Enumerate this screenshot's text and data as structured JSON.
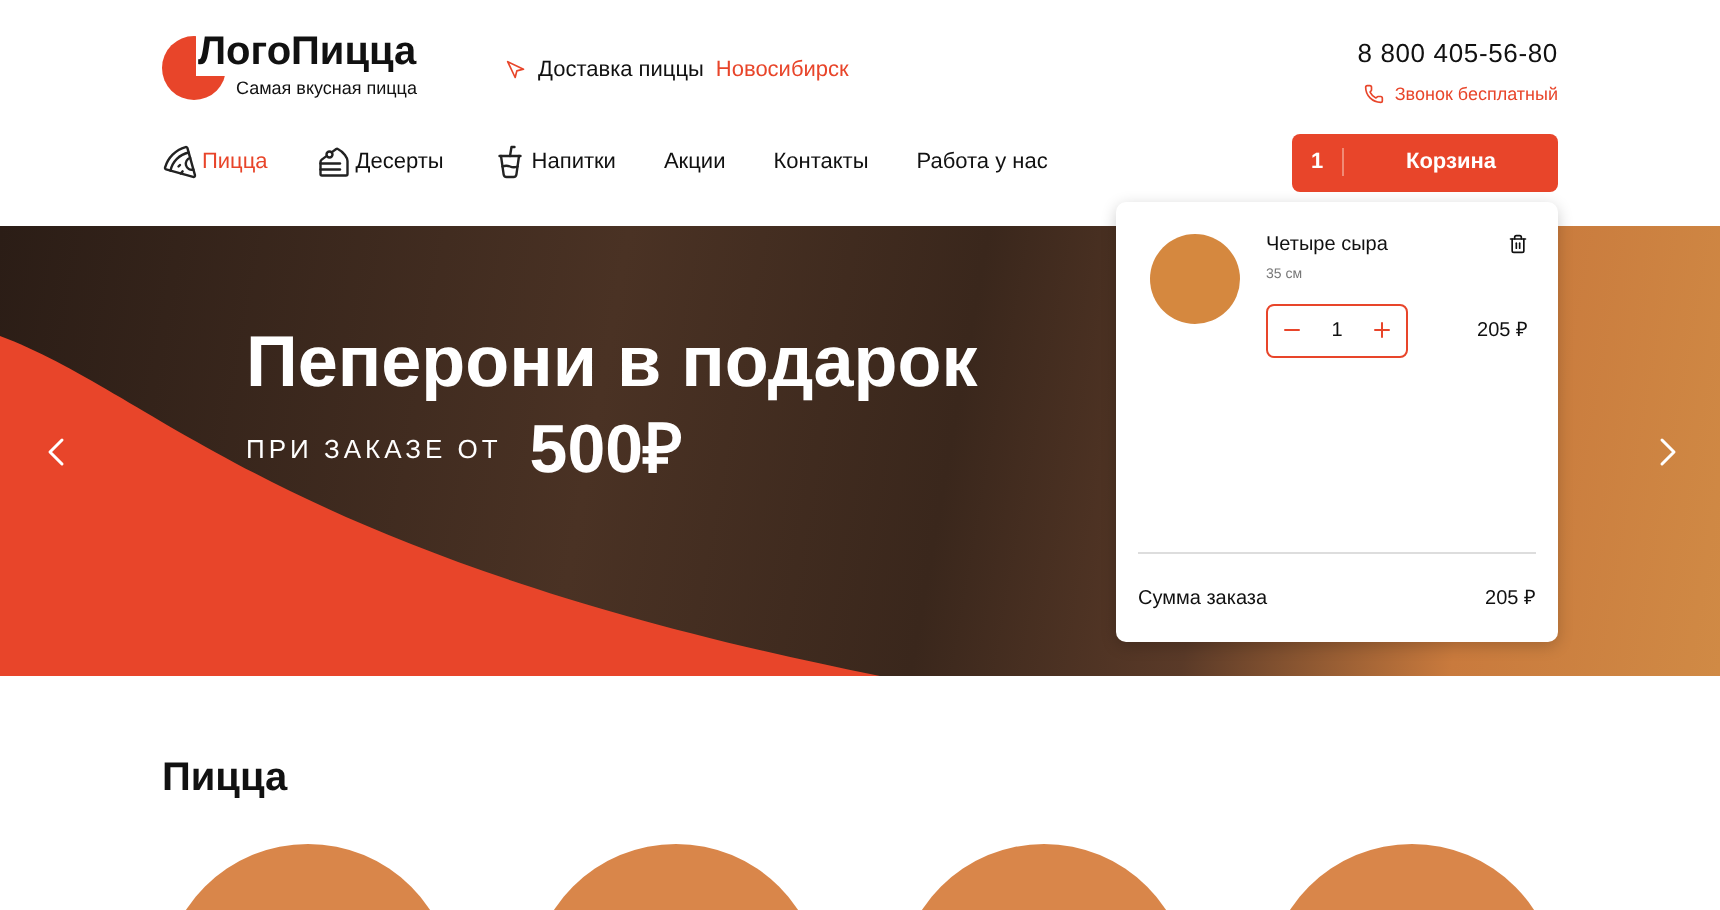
{
  "header": {
    "logo_title": "ЛогоПицца",
    "logo_subtitle": "Самая вкусная пицца",
    "delivery_label": "Доставка пиццы",
    "delivery_city": "Новосибирск",
    "phone": "8 800 405-56-80",
    "callback": "Звонок бесплатный"
  },
  "nav": [
    {
      "label": "Пицца",
      "kind": "pizza",
      "selected": true
    },
    {
      "label": "Десерты",
      "kind": "dessert",
      "selected": false
    },
    {
      "label": "Напитки",
      "kind": "drink",
      "selected": false
    },
    {
      "label": "Акции",
      "kind": "plain",
      "selected": false
    },
    {
      "label": "Контакты",
      "kind": "plain",
      "selected": false
    },
    {
      "label": "Работа у нас",
      "kind": "plain",
      "selected": false
    }
  ],
  "cart_button": {
    "count": "1",
    "label": "Корзина"
  },
  "cart": {
    "items": [
      {
        "name": "Четыре сыра",
        "size": "35 см",
        "quantity": "1",
        "price": "205 ₽"
      }
    ],
    "total_label": "Сумма заказа",
    "total": "205 ₽"
  },
  "banner": {
    "title": "Пеперони в подарок",
    "subtitle": "ПРИ ЗАКАЗЕ ОТ",
    "amount": "500₽"
  },
  "section": {
    "title": "Пицца"
  }
}
